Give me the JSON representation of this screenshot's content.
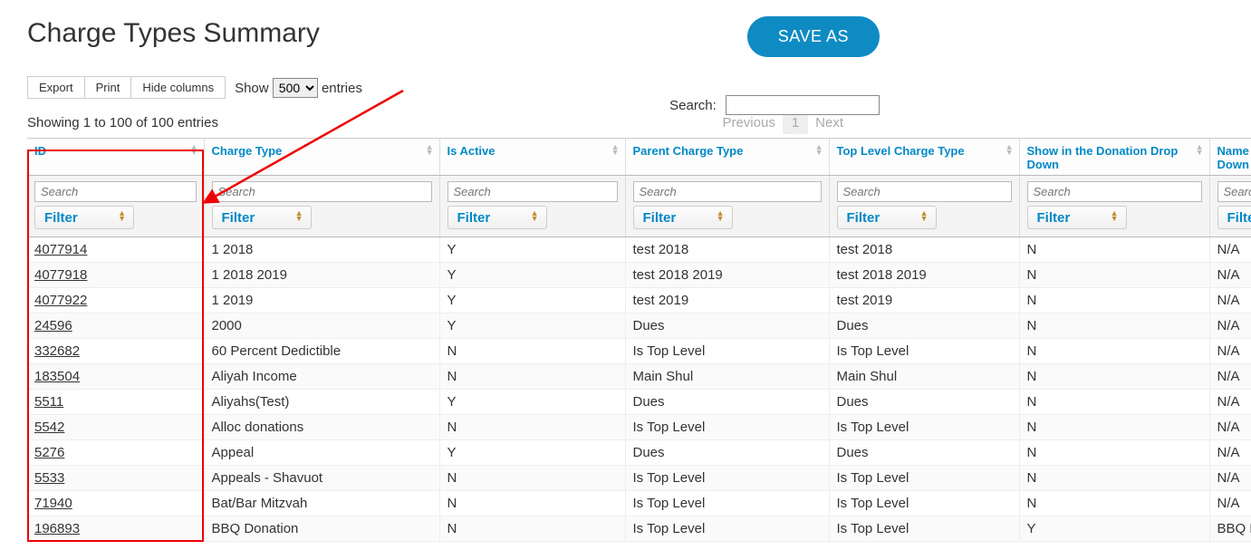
{
  "title": "Charge Types Summary",
  "save_as": "SAVE AS",
  "toolbar": {
    "export": "Export",
    "print": "Print",
    "hide_cols": "Hide columns"
  },
  "show_entries": {
    "prefix": "Show",
    "suffix": "entries",
    "value": "500"
  },
  "search": {
    "label": "Search:"
  },
  "info": "Showing 1 to 100 of 100 entries",
  "pager": {
    "prev": "Previous",
    "page": "1",
    "next": "Next"
  },
  "columns": [
    {
      "key": "id",
      "label": "ID"
    },
    {
      "key": "ct",
      "label": "Charge Type"
    },
    {
      "key": "act",
      "label": "Is Active"
    },
    {
      "key": "par",
      "label": "Parent Charge Type"
    },
    {
      "key": "top",
      "label": "Top Level Charge Type"
    },
    {
      "key": "show",
      "label": "Show in the Donation Drop Down"
    },
    {
      "key": "name",
      "label": "Name of Donation Drop Down"
    }
  ],
  "search_placeholder": "Search",
  "filter_label": "Filter",
  "rows": [
    {
      "id": "4077914",
      "ct": "1 2018",
      "act": "Y",
      "par": "test 2018",
      "top": "test 2018",
      "show": "N",
      "name": "N/A"
    },
    {
      "id": "4077918",
      "ct": "1 2018 2019",
      "act": "Y",
      "par": "test 2018 2019",
      "top": "test 2018 2019",
      "show": "N",
      "name": "N/A"
    },
    {
      "id": "4077922",
      "ct": "1 2019",
      "act": "Y",
      "par": "test 2019",
      "top": "test 2019",
      "show": "N",
      "name": "N/A"
    },
    {
      "id": "24596",
      "ct": "2000",
      "act": "Y",
      "par": "Dues",
      "top": "Dues",
      "show": "N",
      "name": "N/A"
    },
    {
      "id": "332682",
      "ct": "60 Percent Dedictible",
      "act": "N",
      "par": "Is Top Level",
      "top": "Is Top Level",
      "show": "N",
      "name": "N/A"
    },
    {
      "id": "183504",
      "ct": "Aliyah Income",
      "act": "N",
      "par": "Main Shul",
      "top": "Main Shul",
      "show": "N",
      "name": "N/A"
    },
    {
      "id": "5511",
      "ct": "Aliyahs(Test)",
      "act": "Y",
      "par": "Dues",
      "top": "Dues",
      "show": "N",
      "name": "N/A"
    },
    {
      "id": "5542",
      "ct": "Alloc donations",
      "act": "N",
      "par": "Is Top Level",
      "top": "Is Top Level",
      "show": "N",
      "name": "N/A"
    },
    {
      "id": "5276",
      "ct": "Appeal",
      "act": "Y",
      "par": "Dues",
      "top": "Dues",
      "show": "N",
      "name": "N/A"
    },
    {
      "id": "5533",
      "ct": "Appeals - Shavuot",
      "act": "N",
      "par": "Is Top Level",
      "top": "Is Top Level",
      "show": "N",
      "name": "N/A"
    },
    {
      "id": "71940",
      "ct": "Bat/Bar Mitzvah",
      "act": "N",
      "par": "Is Top Level",
      "top": "Is Top Level",
      "show": "N",
      "name": "N/A"
    },
    {
      "id": "196893",
      "ct": "BBQ Donation",
      "act": "N",
      "par": "Is Top Level",
      "top": "Is Top Level",
      "show": "Y",
      "name": "BBQ Donation"
    }
  ]
}
